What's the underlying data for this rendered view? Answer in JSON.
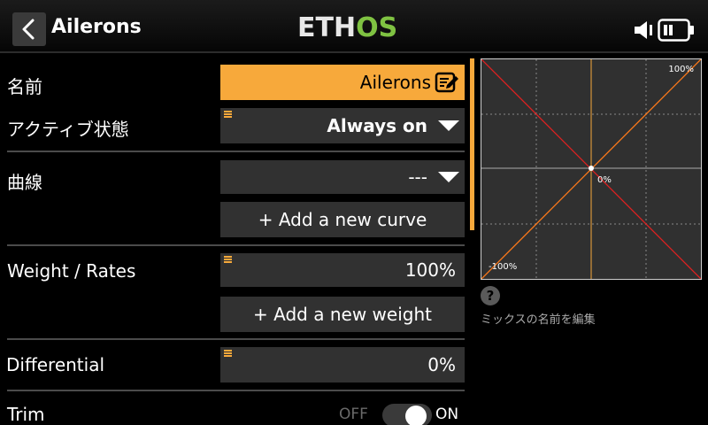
{
  "header": {
    "title": "Ailerons",
    "logo_part1": "ETH",
    "logo_part2": "OS",
    "icons": [
      "chevron-left-icon",
      "speaker-icon",
      "battery-icon"
    ]
  },
  "rows": {
    "name": {
      "label": "名前",
      "value": "Ailerons"
    },
    "active": {
      "label": "アクティブ状態",
      "value": "Always on"
    },
    "curve": {
      "label": "曲線",
      "value": "---",
      "add_label": "+ Add a new curve"
    },
    "weight": {
      "label": "Weight / Rates",
      "value": "100%",
      "add_label": "+ Add a new weight"
    },
    "differential": {
      "label": "Differential",
      "value": "0%"
    },
    "trim": {
      "label": "Trim",
      "off_label": "OFF",
      "on_label": "ON",
      "state": "on"
    }
  },
  "graph": {
    "top_right_label": "100%",
    "center_label": "0%",
    "bottom_left_label": "-100%"
  },
  "help": {
    "icon": "?",
    "text": "ミックスの名前を編集"
  },
  "colors": {
    "accent": "#f7a93b",
    "logo_green": "#7fc242",
    "curve_orange": "#ff7a1a",
    "curve_red": "#e02020"
  }
}
